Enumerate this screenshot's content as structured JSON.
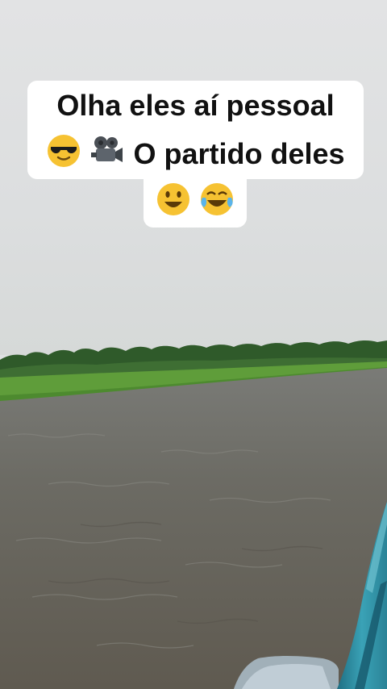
{
  "caption": {
    "line1": "Olha eles aí pessoal",
    "line2_text": "O partido deles",
    "line2_icons": [
      "sunglasses-face-emoji",
      "movie-camera-emoji"
    ],
    "line3_icons": [
      "smiling-face-emoji",
      "tears-of-joy-emoji"
    ]
  },
  "colors": {
    "caption_bg": "#ffffff",
    "water": "#6b6a62",
    "grass": "#5f9d3a",
    "trees": "#2f5a2a",
    "boat": "#2c8aa0"
  }
}
